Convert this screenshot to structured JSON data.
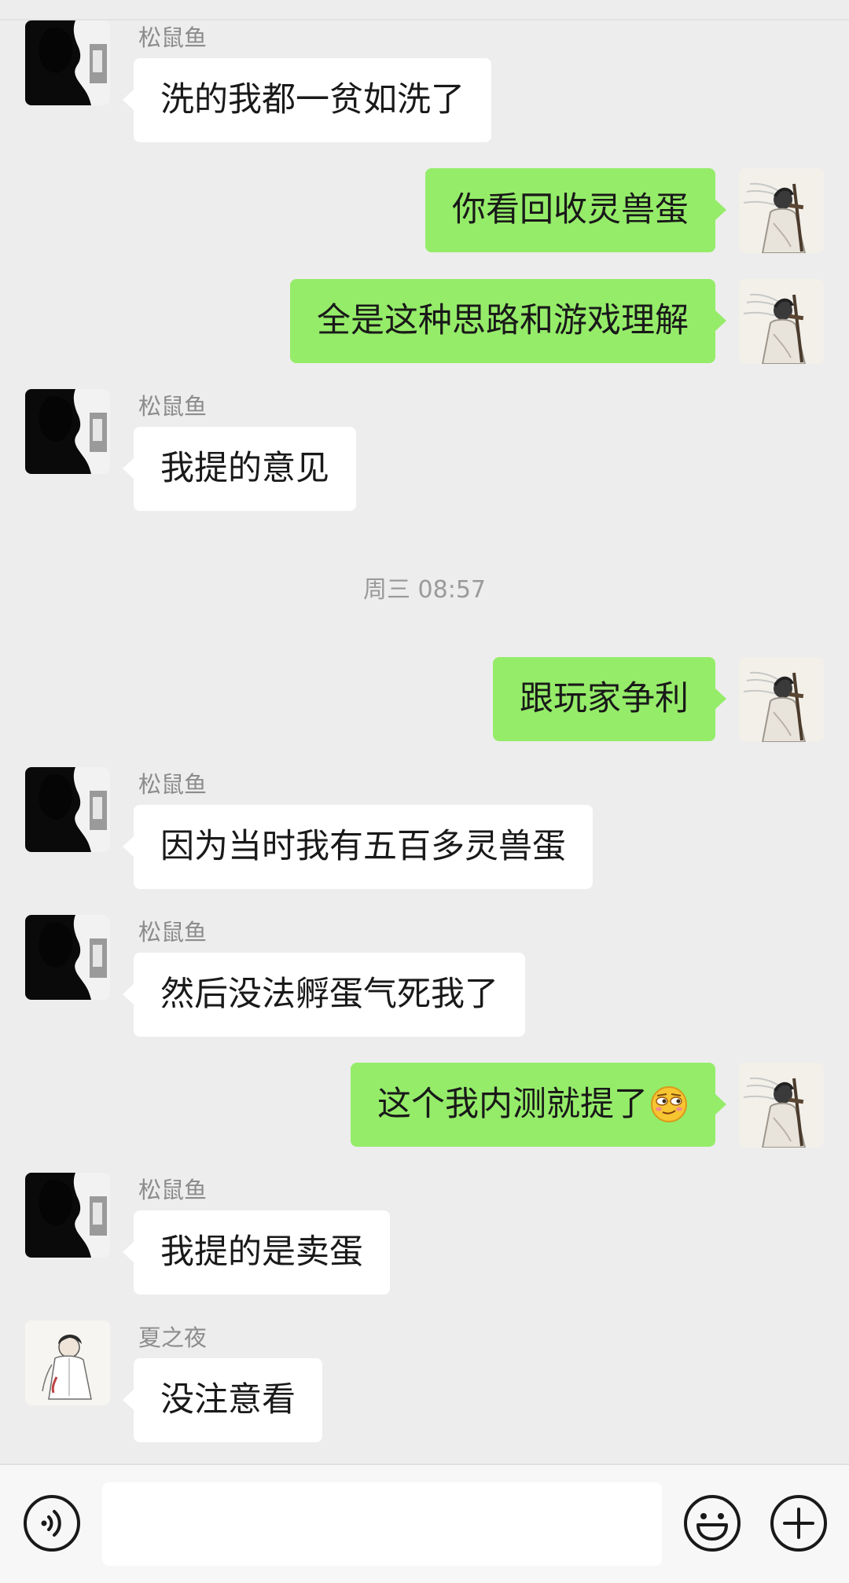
{
  "contacts": {
    "songshuyu": "松鼠鱼",
    "xiazhiye": "夏之夜"
  },
  "messages": [
    {
      "id": "m1",
      "direction": "in",
      "sender": "松鼠鱼",
      "text": "洗的我都一贫如洗了"
    },
    {
      "id": "m2",
      "direction": "out",
      "text": "你看回收灵兽蛋"
    },
    {
      "id": "m3",
      "direction": "out",
      "text": "全是这种思路和游戏理解"
    },
    {
      "id": "m4",
      "direction": "in",
      "sender": "松鼠鱼",
      "text": "我提的意见"
    },
    {
      "id": "m5",
      "direction": "out",
      "text": "跟玩家争利"
    },
    {
      "id": "m6",
      "direction": "in",
      "sender": "松鼠鱼",
      "text": "因为当时我有五百多灵兽蛋"
    },
    {
      "id": "m7",
      "direction": "in",
      "sender": "松鼠鱼",
      "text": "然后没法孵蛋气死我了"
    },
    {
      "id": "m8",
      "direction": "out",
      "text": "这个我内测就提了",
      "emoji": "smirk-face-emoji"
    },
    {
      "id": "m9",
      "direction": "in",
      "sender": "松鼠鱼",
      "text": "我提的是卖蛋"
    },
    {
      "id": "m10",
      "direction": "in",
      "sender": "夏之夜",
      "text": "没注意看"
    }
  ],
  "timestamp": "周三 08:57",
  "input_bar": {
    "voice_icon": "voice-icon",
    "input_value": "",
    "emoji_icon": "emoji-face-icon",
    "plus_icon": "plus-circle-icon"
  },
  "colors": {
    "background": "#ededed",
    "incoming_bubble": "#ffffff",
    "outgoing_bubble": "#95ec69",
    "text": "#191919",
    "secondary_text": "#8c8c8c"
  }
}
